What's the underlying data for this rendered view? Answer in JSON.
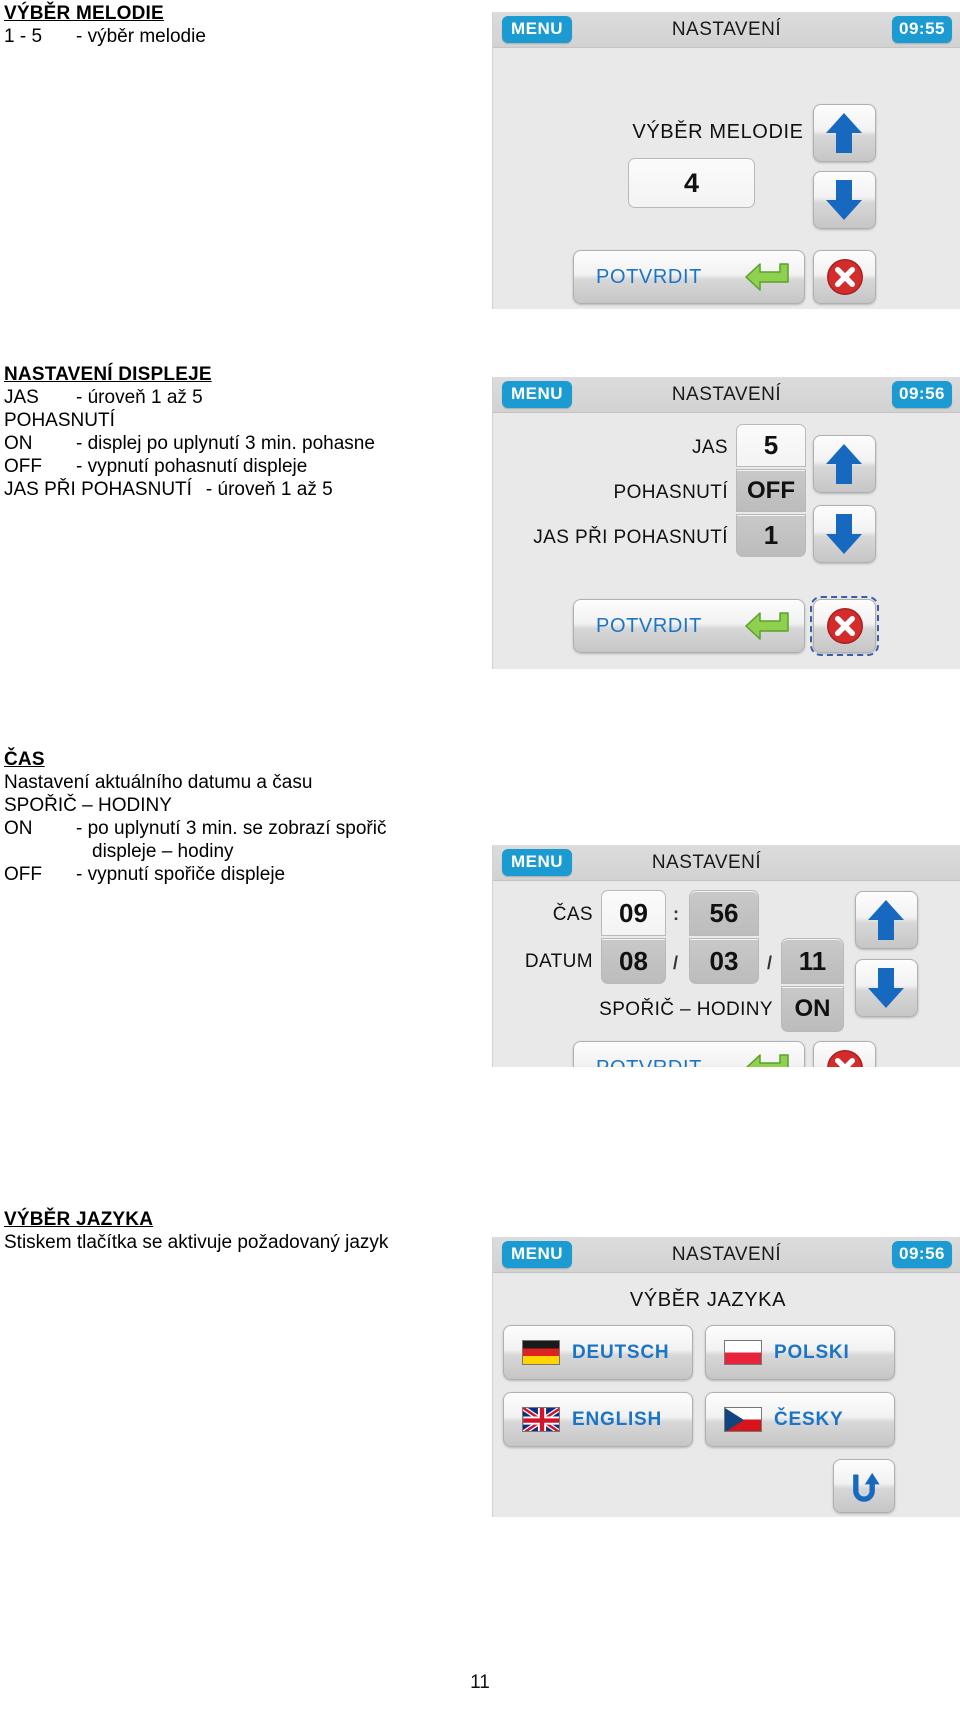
{
  "colors": {
    "accent_blue": "#1b9bd1",
    "label_blue": "#1c74c4",
    "arrow_blue": "#1769c0",
    "close_red": "#d42b2b",
    "confirm_green": "#8fd14f",
    "screen_bg": "#e9e9e9"
  },
  "sections": [
    {
      "title": "VÝBĚR MELODIE",
      "lines": [
        {
          "key": "1 - 5",
          "text": "- výběr melodie"
        }
      ]
    },
    {
      "title": "NASTAVENÍ DISPLEJE",
      "lines": [
        {
          "key": "JAS",
          "text": "- úroveň 1 až 5"
        },
        {
          "key": "POHASNUTÍ",
          "text": ""
        },
        {
          "key": "ON",
          "text": "- displej po uplynutí 3 min. pohasne"
        },
        {
          "key": "OFF",
          "text": "- vypnutí pohasnutí displeje"
        },
        {
          "key": "JAS PŘI POHASNUTÍ",
          "text": "- úroveň 1 až 5",
          "wide": true
        }
      ]
    },
    {
      "title": "ČAS",
      "lines": [
        {
          "key": "",
          "text": "Nastavení aktuálního datumu a času",
          "plain": true
        },
        {
          "key": "",
          "text": "SPOŘIČ – HODINY",
          "plain": true
        },
        {
          "key": "ON",
          "text": "- po uplynutí 3 min. se zobrazí spořič"
        },
        {
          "key": "",
          "text": "displeje – hodiny",
          "indent": true
        },
        {
          "key": "OFF",
          "text": "- vypnutí spořiče displeje"
        }
      ]
    },
    {
      "title": "VÝBĚR JAZYKA",
      "lines": [
        {
          "key": "",
          "text": "Stiskem tlačítka se aktivuje požadovaný jazyk",
          "plain": true
        }
      ]
    }
  ],
  "screen_melody": {
    "menu_label": "MENU",
    "title": "NASTAVENÍ",
    "clock": "09:55",
    "caption": "VÝBĚR MELODIE",
    "value": "4",
    "confirm_label": "POTVRDIT",
    "up_icon": "arrow-up-icon",
    "down_icon": "arrow-down-icon",
    "close_icon": "close-circle-icon",
    "enter_icon": "enter-arrow-icon"
  },
  "screen_display": {
    "menu_label": "MENU",
    "title": "NASTAVENÍ",
    "clock": "09:56",
    "rows": [
      {
        "label": "JAS",
        "value": "5",
        "selected": true
      },
      {
        "label": "POHASNUTÍ",
        "value": "OFF",
        "selected": false
      },
      {
        "label": "JAS PŘI POHASNUTÍ",
        "value": "1",
        "selected": false
      }
    ],
    "confirm_label": "POTVRDIT",
    "up_icon": "arrow-up-icon",
    "down_icon": "arrow-down-icon",
    "close_icon": "close-circle-icon",
    "enter_icon": "enter-arrow-icon"
  },
  "screen_time": {
    "menu_label": "MENU",
    "title": "NASTAVENÍ",
    "clock": "",
    "time_label": "ČAS",
    "time_hours": "09",
    "time_colon": ":",
    "time_minutes": "56",
    "date_label": "DATUM",
    "date_day": "08",
    "date_sep1": "/",
    "date_month": "03",
    "date_sep2": "/",
    "date_year": "11",
    "saver_label": "SPOŘIČ – HODINY",
    "saver_value": "ON",
    "confirm_label": "POTVRDIT",
    "up_icon": "arrow-up-icon",
    "down_icon": "arrow-down-icon",
    "close_icon": "close-circle-icon",
    "enter_icon": "enter-arrow-icon"
  },
  "screen_language": {
    "menu_label": "MENU",
    "title": "NASTAVENÍ",
    "clock": "09:56",
    "caption": "VÝBĚR JAZYKA",
    "buttons": [
      {
        "label": "DEUTSCH",
        "flag": "flag-de-icon"
      },
      {
        "label": "POLSKI",
        "flag": "flag-pl-icon"
      },
      {
        "label": "ENGLISH",
        "flag": "flag-gb-icon"
      },
      {
        "label": "ČESKY",
        "flag": "flag-cz-icon"
      }
    ],
    "back_icon": "back-arrow-icon"
  },
  "footer": {
    "page_number": "11"
  }
}
